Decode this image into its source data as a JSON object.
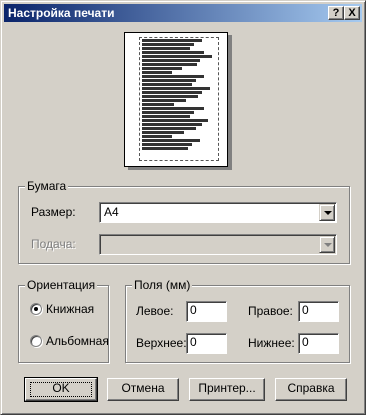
{
  "window": {
    "title": "Настройка печати"
  },
  "titlebar": {
    "help_glyph": "?",
    "close_glyph": "X"
  },
  "paper": {
    "group_label": "Бумага",
    "size_label": "Размер:",
    "size_value": "A4",
    "source_label": "Подача:",
    "source_value": ""
  },
  "orientation": {
    "group_label": "Ориентация",
    "portrait_label": "Книжная",
    "landscape_label": "Альбомная",
    "selected": "portrait"
  },
  "margins": {
    "group_label": "Поля (мм)",
    "left_label": "Левое:",
    "left_value": "0",
    "right_label": "Правое:",
    "right_value": "0",
    "top_label": "Верхнее:",
    "top_value": "0",
    "bottom_label": "Нижнее:",
    "bottom_value": "0"
  },
  "buttons": {
    "ok": "OK",
    "cancel": "Отмена",
    "printer": "Принтер...",
    "help": "Справка"
  },
  "colors": {
    "face": "#d4d0c8",
    "title_start": "#0a246a",
    "title_end": "#a6caf0"
  }
}
